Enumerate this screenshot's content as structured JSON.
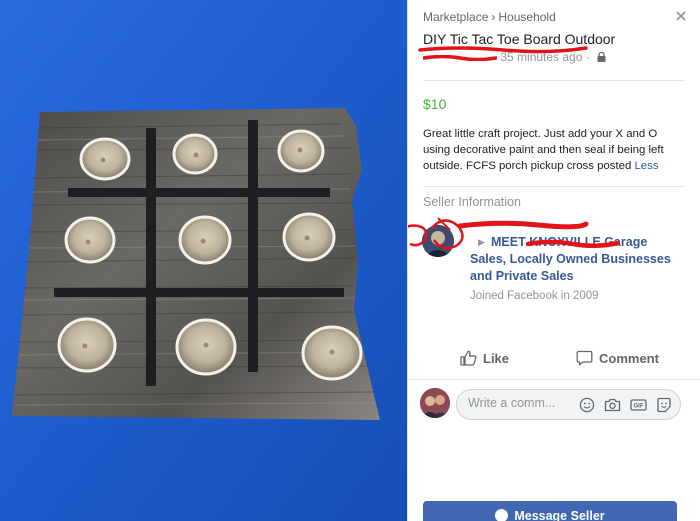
{
  "breadcrumb": {
    "root": "Marketplace",
    "separator": "›",
    "category": "Household"
  },
  "listing": {
    "title": "DIY Tic Tac Toe Board Outdoor",
    "posted_time": "35 minutes ago",
    "separator": "·",
    "price": "$10",
    "description": "Great little craft project.  Just add your X and O using decorative paint and then seal if being left outside.  FCFS porch pickup cross posted",
    "less_label": "Less"
  },
  "seller": {
    "heading": "Seller Information",
    "group_name": "MEET KNOXVILLE Garage Sales, Locally Owned Businesses and Private Sales",
    "joined": "Joined Facebook in 2009"
  },
  "actions": {
    "like": "Like",
    "comment": "Comment"
  },
  "comment_box": {
    "placeholder": "Write a comm..."
  },
  "message_button": {
    "label": "Message Seller"
  },
  "icons": {
    "close": "close-icon",
    "lock": "lock-icon",
    "like": "thumbs-up-icon",
    "comment": "speech-bubble-icon",
    "emoji": "smiley-icon",
    "camera": "camera-icon",
    "gif": "gif-icon",
    "sticker": "sticker-icon",
    "messenger": "messenger-icon"
  },
  "colors": {
    "photo_background": "#1f5fd0",
    "board_wood": "#5b5a57",
    "link": "#385898",
    "price": "#42b72a",
    "redaction": "#e2141a",
    "button": "#4267b2"
  }
}
